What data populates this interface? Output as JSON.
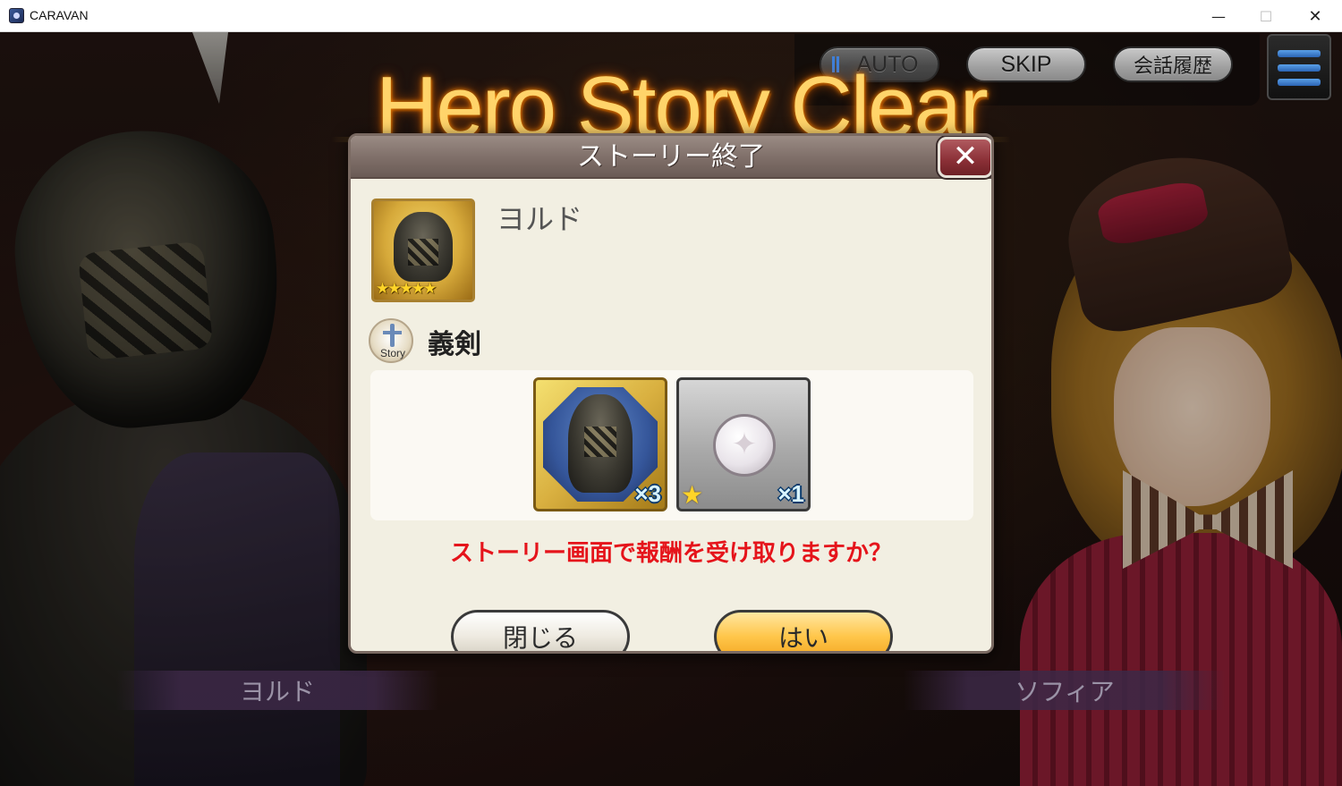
{
  "window": {
    "title": "CARAVAN",
    "minimize": "—",
    "maximize": "☐",
    "close": "✕"
  },
  "scene": {
    "title": "Hero Story Clear",
    "controls": {
      "auto": "AUTO",
      "skip": "SKIP",
      "log": "会話履歴"
    },
    "speaker_left": "ヨルド",
    "speaker_right": "ソフィア"
  },
  "dialog": {
    "title": "ストーリー終了",
    "close_icon": "✕",
    "character": {
      "name": "ヨルド",
      "rarity_stars": "★★★★★"
    },
    "story": {
      "icon_label": "Story",
      "name": "義剣"
    },
    "rewards": [
      {
        "type": "hero-fragment",
        "quantity": "×3"
      },
      {
        "type": "coin",
        "rarity_star": "★",
        "quantity": "×1"
      }
    ],
    "prompt": "ストーリー画面で報酬を受け取りますか？",
    "buttons": {
      "close": "閉じる",
      "yes": "はい"
    }
  },
  "colors": {
    "prompt_text": "#e5141b",
    "yes_button": "#ffc64a",
    "title_glow": "#ffd46a"
  }
}
